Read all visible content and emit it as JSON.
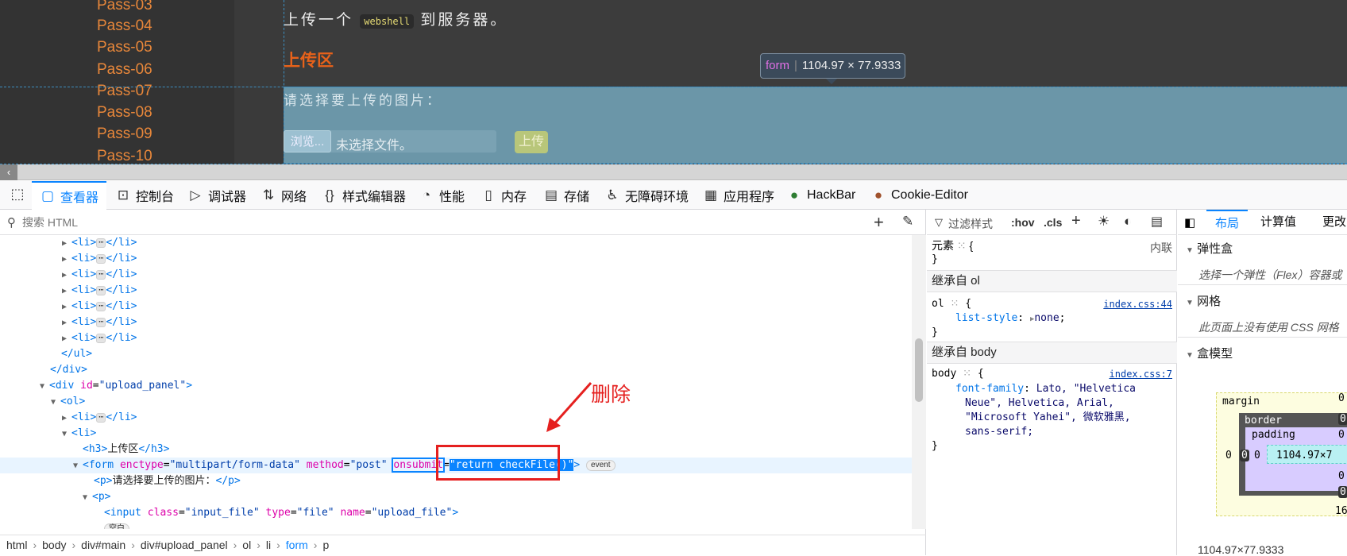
{
  "webpage": {
    "nav_items": [
      "Pass-03",
      "Pass-04",
      "Pass-05",
      "Pass-06",
      "Pass-07",
      "Pass-08",
      "Pass-09",
      "Pass-10"
    ],
    "intro_before": "上传一个",
    "intro_code": "webshell",
    "intro_after": "到服务器。",
    "upload_title": "上传区",
    "form_prompt": "请选择要上传的图片：",
    "browse_label": "浏览...",
    "no_file_label": "未选择文件。",
    "upload_button": "上传",
    "tooltip_tag": "form",
    "tooltip_size": "1104.97 × 77.9333"
  },
  "devtools": {
    "tabs": [
      {
        "label": "查看器",
        "icon": "inspector-icon"
      },
      {
        "label": "控制台",
        "icon": "console-icon"
      },
      {
        "label": "调试器",
        "icon": "debugger-icon"
      },
      {
        "label": "网络",
        "icon": "network-icon"
      },
      {
        "label": "样式编辑器",
        "icon": "style-editor-icon"
      },
      {
        "label": "性能",
        "icon": "performance-icon"
      },
      {
        "label": "内存",
        "icon": "memory-icon"
      },
      {
        "label": "存储",
        "icon": "storage-icon"
      },
      {
        "label": "无障碍环境",
        "icon": "accessibility-icon"
      },
      {
        "label": "应用程序",
        "icon": "application-icon"
      },
      {
        "label": "HackBar",
        "icon": "hackbar-icon"
      },
      {
        "label": "Cookie-Editor",
        "icon": "cookie-icon"
      }
    ],
    "search_placeholder": "搜索 HTML",
    "breadcrumbs": [
      "html",
      "body",
      "div#main",
      "div#upload_panel",
      "ol",
      "li",
      "form",
      "p"
    ],
    "tree": {
      "li_open": "<li>",
      "li_close": "</li>",
      "ellipsis": "⋯",
      "ul_close": "</ul>",
      "div_close": "</div>",
      "div_open": "<div",
      "id_attr": "id",
      "upload_panel_val": "\"upload_panel\"",
      "ol_open": "<ol>",
      "h3_open": "<h3>",
      "h3_text": "上传区",
      "h3_close": "</h3>",
      "form_open": "<form",
      "enctype_attr": "enctype",
      "enctype_val": "\"multipart/form-data\"",
      "method_attr": "method",
      "method_val": "\"post\"",
      "onsubmit_attr": "onsubmit",
      "onsubmit_val": "return checkFile()",
      "event_badge": "event",
      "p_open": "<p>",
      "p_text": "请选择要上传的图片：",
      "p_close": "</p>",
      "input_open": "<input",
      "class_attr": "class",
      "class_val": "\"input_file\"",
      "type_attr": "type",
      "type_val": "\"file\"",
      "name_attr": "name",
      "name_val": "\"upload_file\"",
      "whitespace_badge": "空白"
    },
    "annotation": "删除",
    "rules": {
      "filter_placeholder": "过滤样式",
      "hov": ":hov",
      "cls": ".cls",
      "element_label": "元素",
      "inline_label": "内联",
      "inherit_ol": "继承自 ol",
      "ol_selector": "ol",
      "ol_src": "index.css:44",
      "ol_prop": "list-style",
      "ol_val": "none",
      "inherit_body": "继承自 body",
      "body_selector": "body",
      "body_src": "index.css:7",
      "font_prop": "font-family",
      "font_val_1": "Lato, \"Helvetica",
      "font_val_2": "Neue\", Helvetica, Arial,",
      "font_val_3": "\"Microsoft Yahei\", 微软雅黑,",
      "font_val_4": "sans-serif;"
    },
    "layout": {
      "tabs": [
        "布局",
        "计算值",
        "更改"
      ],
      "flex_head": "弹性盒",
      "flex_note": "选择一个弹性（Flex）容器或",
      "grid_head": "网格",
      "grid_note": "此页面上没有使用 CSS 网格",
      "box_head": "盒模型",
      "margin_label": "margin",
      "border_label": "border",
      "padding_label": "padding",
      "content_size": "1104.97×7",
      "zero": "0",
      "bottom_num": "16",
      "dimensions": "1104.97×77.9333"
    }
  }
}
